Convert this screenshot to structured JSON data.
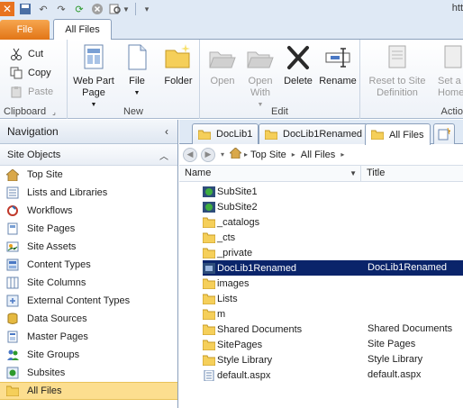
{
  "window": {
    "title_fragment": "htt"
  },
  "tabs": {
    "file": "File",
    "all_files": "All Files"
  },
  "ribbon": {
    "clipboard": {
      "label": "Clipboard",
      "cut": "Cut",
      "copy": "Copy",
      "paste": "Paste"
    },
    "new": {
      "label": "New",
      "web_part_page": "Web Part Page",
      "file": "File",
      "folder": "Folder"
    },
    "edit": {
      "label": "Edit",
      "open": "Open",
      "open_with": "Open With",
      "delete": "Delete",
      "rename": "Rename"
    },
    "actions": {
      "label": "Actio",
      "reset": "Reset to Site Definition",
      "set_as": "Set a",
      "home_page": "Home P"
    }
  },
  "navigation": {
    "title": "Navigation",
    "site_objects": "Site Objects",
    "items": [
      {
        "label": "Top Site",
        "icon": "house-icon"
      },
      {
        "label": "Lists and Libraries",
        "icon": "list-icon"
      },
      {
        "label": "Workflows",
        "icon": "workflow-icon"
      },
      {
        "label": "Site Pages",
        "icon": "page-icon"
      },
      {
        "label": "Site Assets",
        "icon": "assets-icon"
      },
      {
        "label": "Content Types",
        "icon": "content-types-icon"
      },
      {
        "label": "Site Columns",
        "icon": "columns-icon"
      },
      {
        "label": "External Content Types",
        "icon": "external-icon"
      },
      {
        "label": "Data Sources",
        "icon": "database-icon"
      },
      {
        "label": "Master Pages",
        "icon": "master-page-icon"
      },
      {
        "label": "Site Groups",
        "icon": "groups-icon"
      },
      {
        "label": "Subsites",
        "icon": "subsites-icon"
      },
      {
        "label": "All Files",
        "icon": "folder-icon"
      }
    ]
  },
  "doc_tabs": [
    "DocLib1",
    "DocLib1Renamed",
    "All Files"
  ],
  "breadcrumb": {
    "top_site": "Top Site",
    "all_files": "All Files"
  },
  "columns": {
    "name": "Name",
    "title": "Title"
  },
  "files": [
    {
      "name": "SubSite1",
      "title": "",
      "icon": "site"
    },
    {
      "name": "SubSite2",
      "title": "",
      "icon": "site"
    },
    {
      "name": "_catalogs",
      "title": "",
      "icon": "folder"
    },
    {
      "name": "_cts",
      "title": "",
      "icon": "folder"
    },
    {
      "name": "_private",
      "title": "",
      "icon": "folder"
    },
    {
      "name": "DocLib1Renamed",
      "title": "DocLib1Renamed",
      "icon": "library"
    },
    {
      "name": "images",
      "title": "",
      "icon": "folder"
    },
    {
      "name": "Lists",
      "title": "",
      "icon": "folder"
    },
    {
      "name": "m",
      "title": "",
      "icon": "folder"
    },
    {
      "name": "Shared Documents",
      "title": "Shared Documents",
      "icon": "folder"
    },
    {
      "name": "SitePages",
      "title": "Site Pages",
      "icon": "folder"
    },
    {
      "name": "Style Library",
      "title": "Style Library",
      "icon": "folder"
    },
    {
      "name": "default.aspx",
      "title": "default.aspx",
      "icon": "aspx"
    }
  ],
  "colors": {
    "selected_row": "#0a246a",
    "nav_selected": "#fcde8f",
    "file_tab": "#e8731f"
  }
}
